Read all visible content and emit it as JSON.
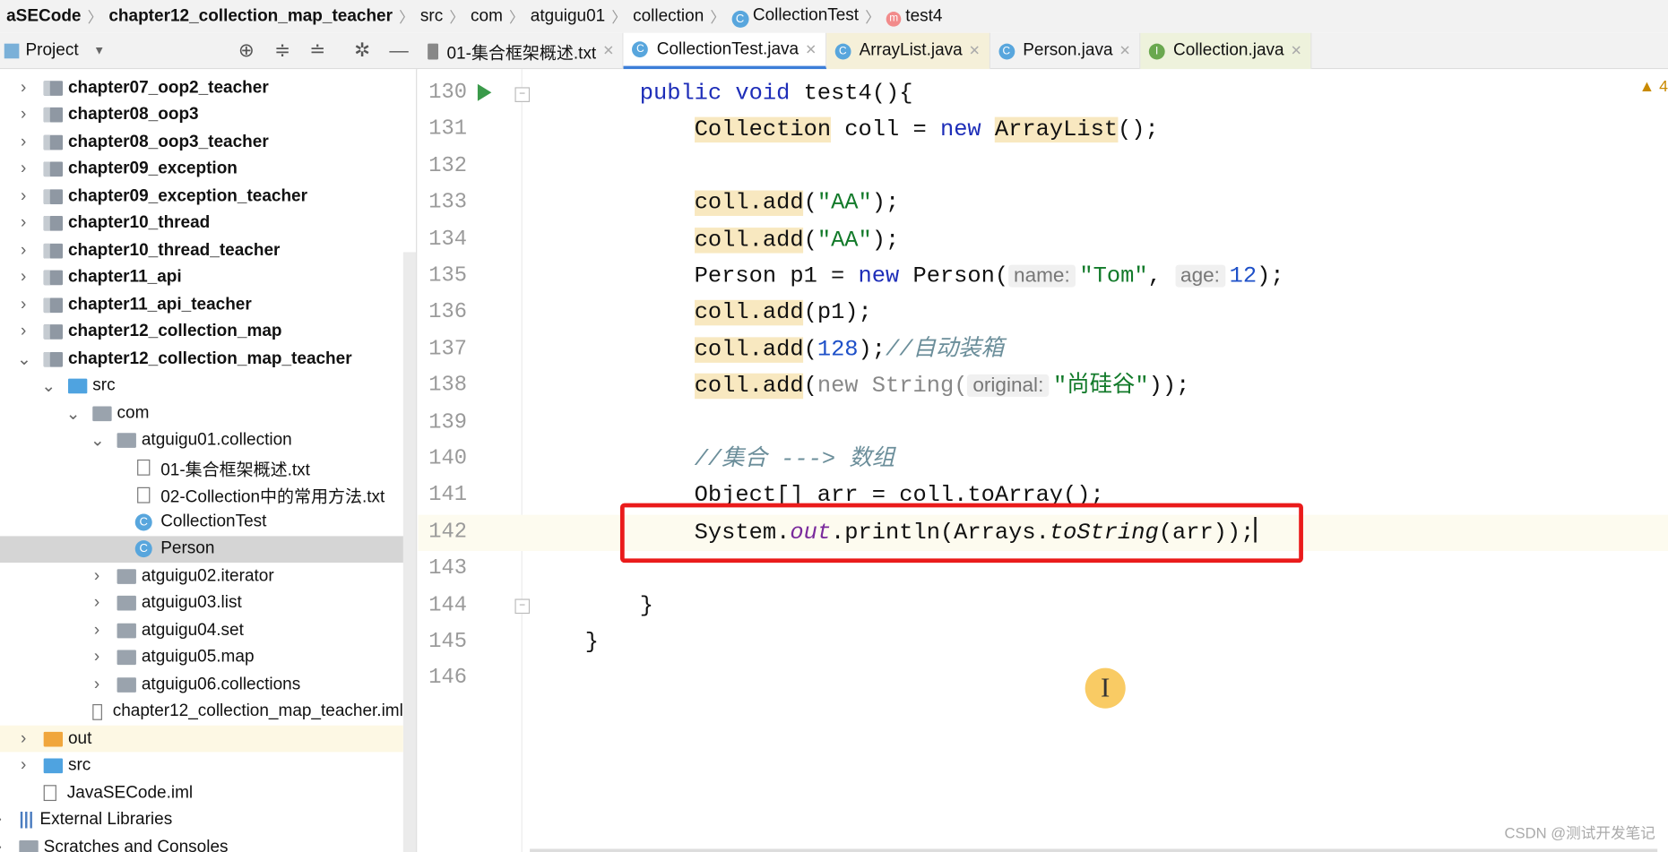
{
  "breadcrumb": [
    "aSECode",
    "chapter12_collection_map_teacher",
    "src",
    "com",
    "atguigu01",
    "collection",
    "CollectionTest",
    "test4"
  ],
  "toolbar": {
    "project_label": "Project"
  },
  "tabs": [
    {
      "label": "01-集合框架概述.txt",
      "icon": "text-file-icon"
    },
    {
      "label": "CollectionTest.java",
      "icon": "class-icon",
      "active": true
    },
    {
      "label": "ArrayList.java",
      "icon": "class-icon"
    },
    {
      "label": "Person.java",
      "icon": "class-icon"
    },
    {
      "label": "Collection.java",
      "icon": "interface-icon"
    }
  ],
  "tree": [
    {
      "label": "chapter07_oop2_teacher",
      "level": 0,
      "type": "module",
      "expanded": false
    },
    {
      "label": "chapter08_oop3",
      "level": 0,
      "type": "module",
      "expanded": false
    },
    {
      "label": "chapter08_oop3_teacher",
      "level": 0,
      "type": "module",
      "expanded": false
    },
    {
      "label": "chapter09_exception",
      "level": 0,
      "type": "module",
      "expanded": false
    },
    {
      "label": "chapter09_exception_teacher",
      "level": 0,
      "type": "module",
      "expanded": false
    },
    {
      "label": "chapter10_thread",
      "level": 0,
      "type": "module",
      "expanded": false
    },
    {
      "label": "chapter10_thread_teacher",
      "level": 0,
      "type": "module",
      "expanded": false
    },
    {
      "label": "chapter11_api",
      "level": 0,
      "type": "module",
      "expanded": false
    },
    {
      "label": "chapter11_api_teacher",
      "level": 0,
      "type": "module",
      "expanded": false
    },
    {
      "label": "chapter12_collection_map",
      "level": 0,
      "type": "module",
      "expanded": false
    },
    {
      "label": "chapter12_collection_map_teacher",
      "level": 0,
      "type": "module",
      "expanded": true
    },
    {
      "label": "src",
      "level": 1,
      "type": "src",
      "expanded": true
    },
    {
      "label": "com",
      "level": 2,
      "type": "package",
      "expanded": true
    },
    {
      "label": "atguigu01.collection",
      "level": 3,
      "type": "package",
      "expanded": true
    },
    {
      "label": "01-集合框架概述.txt",
      "level": 4,
      "type": "file"
    },
    {
      "label": "02-Collection中的常用方法.txt",
      "level": 4,
      "type": "file"
    },
    {
      "label": "CollectionTest",
      "level": 4,
      "type": "class"
    },
    {
      "label": "Person",
      "level": 4,
      "type": "class",
      "selected": true
    },
    {
      "label": "atguigu02.iterator",
      "level": 3,
      "type": "package",
      "expanded": false
    },
    {
      "label": "atguigu03.list",
      "level": 3,
      "type": "package",
      "expanded": false
    },
    {
      "label": "atguigu04.set",
      "level": 3,
      "type": "package",
      "expanded": false
    },
    {
      "label": "atguigu05.map",
      "level": 3,
      "type": "package",
      "expanded": false
    },
    {
      "label": "atguigu06.collections",
      "level": 3,
      "type": "package",
      "expanded": false
    },
    {
      "label": "chapter12_collection_map_teacher.iml",
      "level": 2,
      "type": "iml"
    },
    {
      "label": "out",
      "level": 0,
      "type": "out",
      "expanded": false
    },
    {
      "label": "src",
      "level": 0,
      "type": "src",
      "expanded": false
    },
    {
      "label": "JavaSECode.iml",
      "level": 0,
      "type": "iml"
    },
    {
      "label": "External Libraries",
      "level": -1,
      "type": "lib",
      "expanded": false
    },
    {
      "label": "Scratches and Consoles",
      "level": -1,
      "type": "scratch",
      "expanded": false
    }
  ],
  "editor": {
    "warning_count": "4",
    "lines": [
      {
        "n": "130",
        "t": [
          [
            "    public void ",
            "kw"
          ],
          [
            "test4(){",
            ""
          ]
        ]
      },
      {
        "n": "131",
        "t": [
          [
            "        ",
            ""
          ],
          [
            "Collection",
            "hlt"
          ],
          [
            " coll = ",
            ""
          ],
          [
            "new",
            "kw"
          ],
          [
            " ",
            ""
          ],
          [
            "ArrayList",
            "hlt"
          ],
          [
            "();",
            ""
          ]
        ]
      },
      {
        "n": "132",
        "t": []
      },
      {
        "n": "133",
        "t": [
          [
            "        ",
            ""
          ],
          [
            "coll.add",
            "hlt"
          ],
          [
            "(",
            ""
          ],
          [
            "\"AA\"",
            "str"
          ],
          [
            ");",
            ""
          ]
        ]
      },
      {
        "n": "134",
        "t": [
          [
            "        ",
            ""
          ],
          [
            "coll.add",
            "hlt"
          ],
          [
            "(",
            ""
          ],
          [
            "\"AA\"",
            "str"
          ],
          [
            ");",
            ""
          ]
        ]
      },
      {
        "n": "135",
        "t": [
          [
            "        Person p1 = ",
            ""
          ],
          [
            "new",
            "kw"
          ],
          [
            " Person(",
            ""
          ],
          [
            "name:",
            "hint"
          ],
          [
            "\"Tom\"",
            "str"
          ],
          [
            ", ",
            ""
          ],
          [
            "age:",
            "hint"
          ],
          [
            "12",
            "num"
          ],
          [
            ");",
            ""
          ]
        ]
      },
      {
        "n": "136",
        "t": [
          [
            "        ",
            ""
          ],
          [
            "coll.add",
            "hlt"
          ],
          [
            "(p1);",
            ""
          ]
        ]
      },
      {
        "n": "137",
        "t": [
          [
            "        ",
            ""
          ],
          [
            "coll.add",
            "hlt"
          ],
          [
            "(",
            ""
          ],
          [
            "128",
            "num"
          ],
          [
            ");",
            ""
          ],
          [
            "//自动装箱",
            "cm"
          ]
        ]
      },
      {
        "n": "138",
        "t": [
          [
            "        ",
            ""
          ],
          [
            "coll.add",
            "hlt"
          ],
          [
            "(",
            ""
          ],
          [
            "new String(",
            "gray"
          ],
          [
            "original:",
            "hint"
          ],
          [
            "\"尚硅谷\"",
            "str"
          ],
          [
            "));",
            ""
          ]
        ]
      },
      {
        "n": "139",
        "t": []
      },
      {
        "n": "140",
        "t": [
          [
            "        ",
            ""
          ],
          [
            "//集合 ---> 数组",
            "cm"
          ]
        ]
      },
      {
        "n": "141",
        "t": [
          [
            "        Object[] arr = coll.toArray();",
            ""
          ]
        ]
      },
      {
        "n": "142",
        "t": [
          [
            "        System.",
            ""
          ],
          [
            "out",
            "fld"
          ],
          [
            ".println(Arrays.",
            ""
          ],
          [
            "toString",
            "it"
          ],
          [
            "(arr));",
            ""
          ]
        ],
        "current": true
      },
      {
        "n": "143",
        "t": []
      },
      {
        "n": "144",
        "t": [
          [
            "    }",
            ""
          ]
        ]
      },
      {
        "n": "145",
        "t": [
          [
            "}",
            ""
          ]
        ]
      },
      {
        "n": "146",
        "t": []
      }
    ]
  },
  "watermark": "CSDN @测试开发笔记",
  "colors": {
    "accent": "#3c7ed8",
    "highlight_box": "#ea1b1b",
    "keyword": "#1d2db8",
    "string": "#127a2a"
  }
}
